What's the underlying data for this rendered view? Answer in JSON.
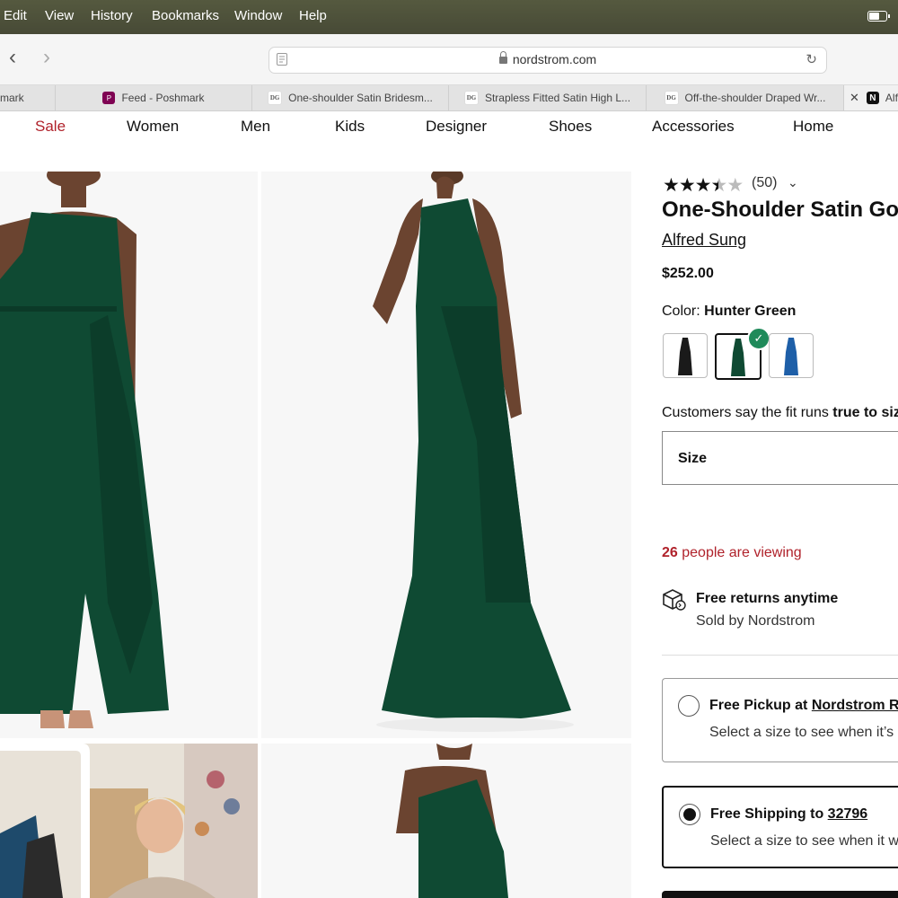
{
  "menubar": {
    "items": [
      "Edit",
      "View",
      "History",
      "Bookmarks",
      "Window",
      "Help"
    ]
  },
  "browser": {
    "url": "nordstrom.com",
    "tabs": [
      {
        "label": "mark",
        "favicon": "none"
      },
      {
        "label": "Feed - Poshmark",
        "favicon": "poshmark-icon"
      },
      {
        "label": "One-shoulder Satin Bridesm...",
        "favicon": "dg-icon"
      },
      {
        "label": "Strapless Fitted Satin High L...",
        "favicon": "dg-icon"
      },
      {
        "label": "Off-the-shoulder Draped Wr...",
        "favicon": "dg-icon"
      },
      {
        "label": "Alf",
        "favicon": "nordstrom-icon"
      }
    ]
  },
  "nav": {
    "items": [
      "Sale",
      "Women",
      "Men",
      "Kids",
      "Designer",
      "Shoes",
      "Accessories",
      "Home"
    ],
    "sale_color": "#b0222b"
  },
  "product": {
    "rating": 3.5,
    "review_count": "(50)",
    "title": "One-Shoulder Satin Gow",
    "brand": "Alfred Sung",
    "price": "$252.00",
    "color_label": "Color:",
    "color_value": "Hunter Green",
    "swatches": [
      {
        "name": "Black",
        "color": "#1a1a1a"
      },
      {
        "name": "Hunter Green",
        "color": "#0f4a33",
        "selected": true
      },
      {
        "name": "Blue",
        "color": "#1e5fa8"
      }
    ],
    "fit_text": "Customers say the fit runs",
    "fit_value": "true to siz",
    "size_label": "Size",
    "viewing_count": "26",
    "viewing_text": "people are viewing",
    "returns_title": "Free returns anytime",
    "returns_sub": "Sold by Nordstrom",
    "pickup_prefix": "Free Pickup at",
    "pickup_store": "Nordstrom Ra",
    "pickup_sub": "Select a size to see when it’s a",
    "shipping_prefix": "Free Shipping to",
    "shipping_zip": "32796",
    "shipping_sub": "Select a size to see when it w"
  },
  "colors": {
    "dress": "#0f4a33",
    "accent_red": "#b0222b",
    "check_green": "#1f8a5a"
  }
}
